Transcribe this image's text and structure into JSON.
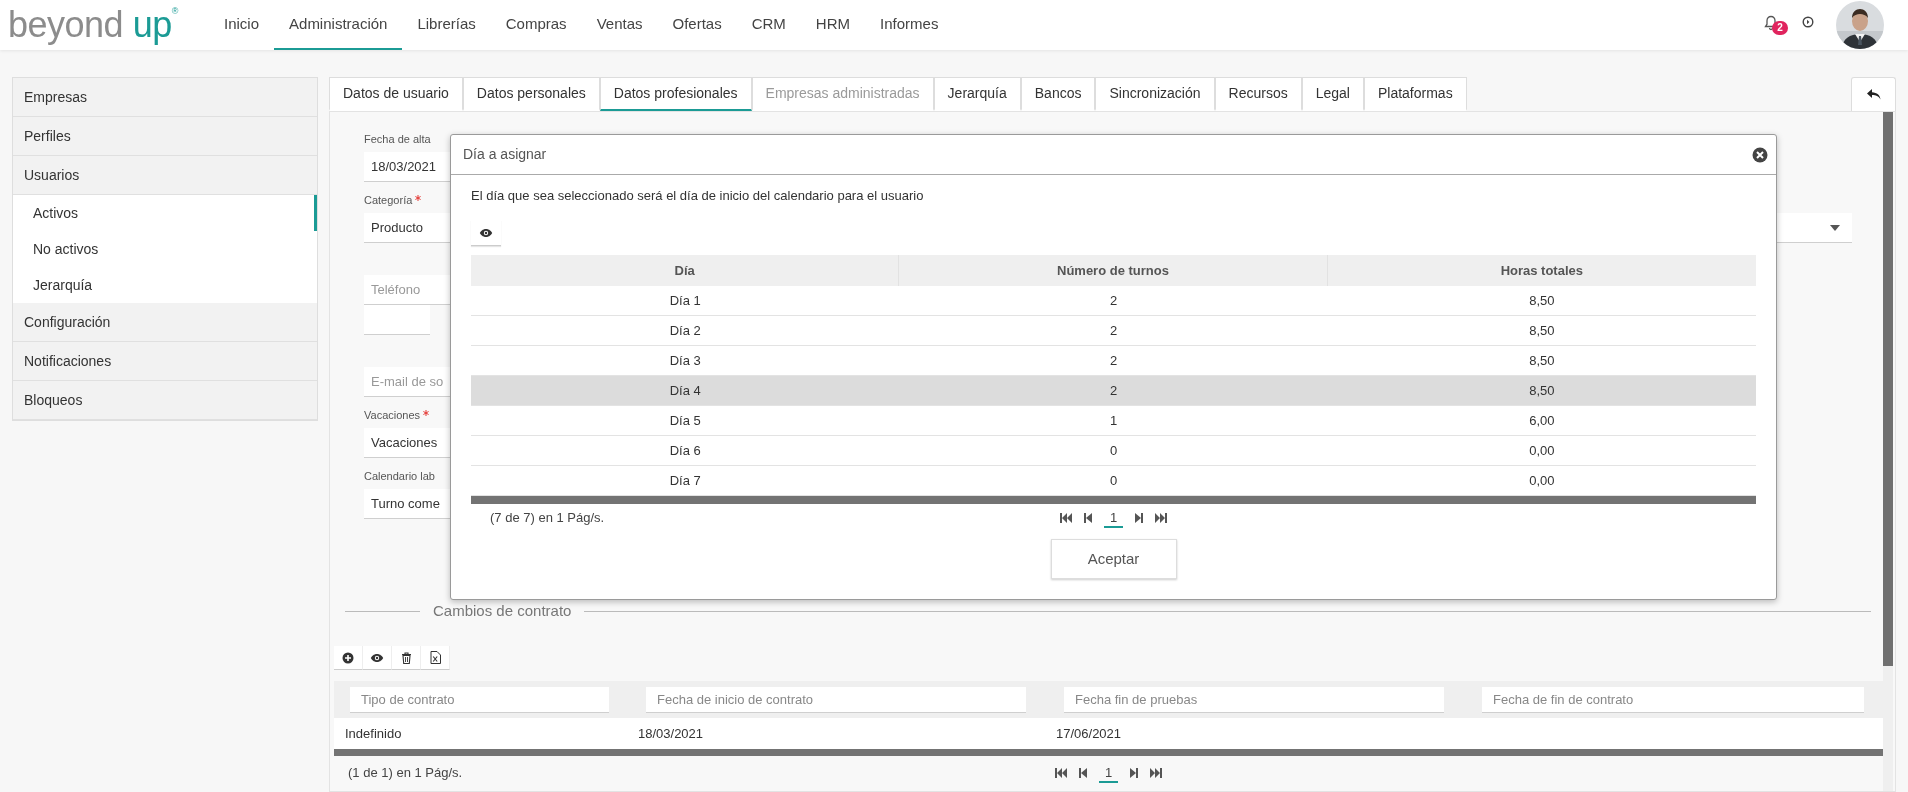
{
  "header": {
    "logo": {
      "text": "beyond",
      "accent": "up",
      "mark": "®"
    },
    "nav": [
      {
        "label": "Inicio",
        "selected": false
      },
      {
        "label": "Administración",
        "selected": true
      },
      {
        "label": "Librerías",
        "selected": false
      },
      {
        "label": "Compras",
        "selected": false
      },
      {
        "label": "Ventas",
        "selected": false
      },
      {
        "label": "Ofertas",
        "selected": false
      },
      {
        "label": "CRM",
        "selected": false
      },
      {
        "label": "HRM",
        "selected": false
      },
      {
        "label": "Informes",
        "selected": false
      }
    ],
    "notifications": {
      "count": "2"
    }
  },
  "sidebar": {
    "items": [
      {
        "label": "Empresas"
      },
      {
        "label": "Perfiles"
      },
      {
        "label": "Usuarios",
        "children": [
          {
            "label": "Activos",
            "selected": true
          },
          {
            "label": "No activos",
            "selected": false
          },
          {
            "label": "Jerarquía",
            "selected": false
          }
        ]
      },
      {
        "label": "Configuración"
      },
      {
        "label": "Notificaciones"
      },
      {
        "label": "Bloqueos"
      }
    ]
  },
  "tabs": [
    {
      "label": "Datos de usuario",
      "selected": false,
      "disabled": false
    },
    {
      "label": "Datos personales",
      "selected": false,
      "disabled": false
    },
    {
      "label": "Datos profesionales",
      "selected": true,
      "disabled": false
    },
    {
      "label": "Empresas administradas",
      "selected": false,
      "disabled": true
    },
    {
      "label": "Jerarquía",
      "selected": false,
      "disabled": false
    },
    {
      "label": "Bancos",
      "selected": false,
      "disabled": false
    },
    {
      "label": "Sincronización",
      "selected": false,
      "disabled": false
    },
    {
      "label": "Recursos",
      "selected": false,
      "disabled": false
    },
    {
      "label": "Legal",
      "selected": false,
      "disabled": false
    },
    {
      "label": "Plataformas",
      "selected": false,
      "disabled": false
    }
  ],
  "form": {
    "fields": [
      {
        "kind": "labeled",
        "label": "Fecha de alta",
        "required": false,
        "value": "18/03/2021"
      },
      {
        "kind": "select",
        "label": "Categoría",
        "required": true,
        "value": "Producto"
      },
      {
        "kind": "input",
        "placeholder": "Teléfono"
      },
      {
        "kind": "blank"
      },
      {
        "kind": "input",
        "placeholder": "E-mail de so"
      },
      {
        "kind": "labeled",
        "label": "Vacaciones",
        "required": true,
        "value": "Vacaciones"
      },
      {
        "kind": "labeled",
        "label": "Calendario lab",
        "required": false,
        "value": "Turno come"
      }
    ]
  },
  "contract_changes": {
    "legend": "Cambios de contrato",
    "filters": [
      {
        "placeholder": "Tipo de contrato"
      },
      {
        "placeholder": "Fecha de inicio de contrato"
      },
      {
        "placeholder": "Fecha fin de pruebas"
      },
      {
        "placeholder": "Fecha de fin de contrato"
      }
    ],
    "rows": [
      {
        "cells": [
          "Indefinido",
          "18/03/2021",
          "17/06/2021"
        ],
        "selected": false
      }
    ],
    "summary": "(1 de 1) en 1 Pág/s.",
    "pages": [
      {
        "label": "1",
        "selected": true
      }
    ]
  },
  "dialog": {
    "title": "Día a asignar",
    "description": "El día que sea seleccionado será el día de inicio del calendario para el usuario",
    "table": {
      "columns": [
        "Día",
        "Número de turnos",
        "Horas totales"
      ],
      "rows": [
        {
          "cells": [
            "Día 1",
            "2",
            "8,50"
          ],
          "selected": false
        },
        {
          "cells": [
            "Día 2",
            "2",
            "8,50"
          ],
          "selected": false
        },
        {
          "cells": [
            "Día 3",
            "2",
            "8,50"
          ],
          "selected": false
        },
        {
          "cells": [
            "Día 4",
            "2",
            "8,50"
          ],
          "selected": true
        },
        {
          "cells": [
            "Día 5",
            "1",
            "6,00"
          ],
          "selected": false
        },
        {
          "cells": [
            "Día 6",
            "0",
            "0,00"
          ],
          "selected": false
        },
        {
          "cells": [
            "Día 7",
            "0",
            "0,00"
          ],
          "selected": false
        }
      ]
    },
    "summary": "(7 de 7) en 1 Pág/s.",
    "pages": [
      {
        "label": "1",
        "selected": true
      }
    ],
    "button": "Aceptar"
  }
}
